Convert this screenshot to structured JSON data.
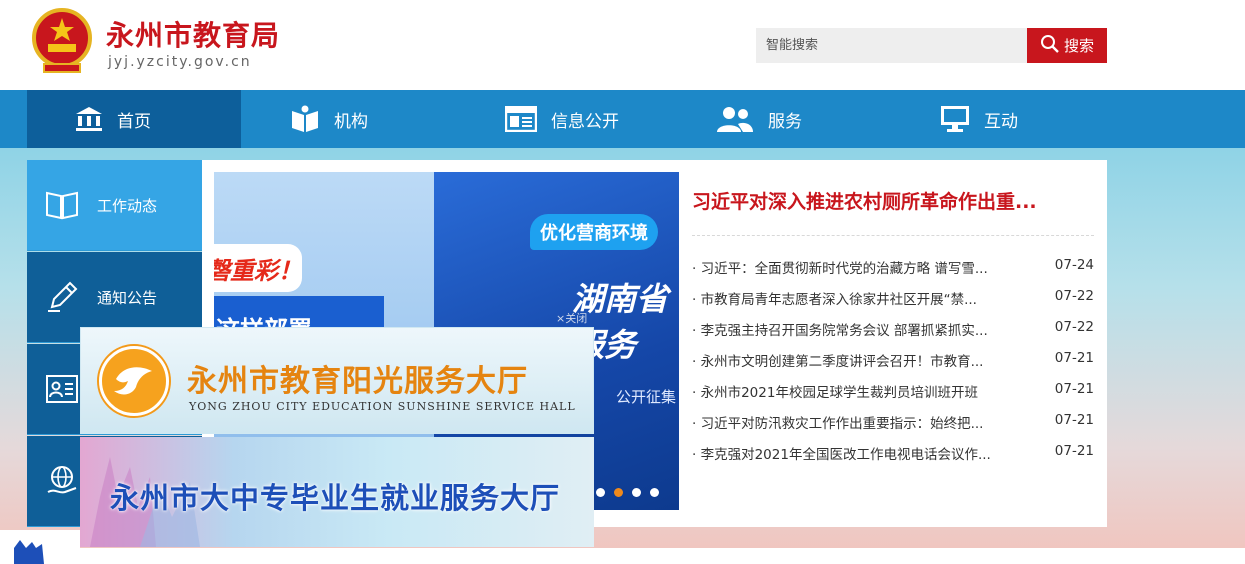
{
  "header": {
    "title": "永州市教育局",
    "domain": "jyj.yzcity.gov.cn",
    "search_placeholder": "智能搜索",
    "search_label": "搜索"
  },
  "nav": [
    {
      "label": "首页",
      "icon": "bank-icon"
    },
    {
      "label": "机构",
      "icon": "book-user-icon"
    },
    {
      "label": "信息公开",
      "icon": "newspaper-icon"
    },
    {
      "label": "服务",
      "icon": "users-icon"
    },
    {
      "label": "互动",
      "icon": "monitor-icon"
    }
  ],
  "sidebar": [
    {
      "label": "工作动态",
      "icon": "open-book-icon"
    },
    {
      "label": "通知公告",
      "icon": "pen-icon"
    },
    {
      "label": "",
      "icon": "id-card-icon"
    },
    {
      "label": "",
      "icon": "globe-hand-icon"
    }
  ],
  "slider": {
    "left_badge": "磬重彩！",
    "left_text": "这样部署",
    "tag": "优化营商环境",
    "big_line1": "湖南省",
    "big_line2": "服务",
    "sub": "公开征集",
    "dots": 5,
    "active_dot": 1
  },
  "news": {
    "headline": "习近平对深入推进农村厕所革命作出重...",
    "items": [
      {
        "title": "· 习近平：全面贯彻新时代党的治藏方略 谱写雪...",
        "date": "07-24"
      },
      {
        "title": "· 市教育局青年志愿者深入徐家井社区开展“禁...",
        "date": "07-22"
      },
      {
        "title": "· 李克强主持召开国务院常务会议 部署抓紧抓实...",
        "date": "07-22"
      },
      {
        "title": "· 永州市文明创建第二季度讲评会召开！市教育...",
        "date": "07-21"
      },
      {
        "title": "· 永州市2021年校园足球学生裁判员培训班开班",
        "date": "07-21"
      },
      {
        "title": "· 习近平对防汛救灾工作作出重要指示：始终把...",
        "date": "07-21"
      },
      {
        "title": "· 李克强对2021年全国医改工作电视电话会议作...",
        "date": "07-21"
      }
    ]
  },
  "floats": {
    "close_label": "×关闭",
    "sunshine_title": "永州市教育阳光服务大厅",
    "sunshine_en": "YONG ZHOU CITY EDUCATION SUNSHINE SERVICE HALL",
    "employment_title": "永州市大中专毕业生就业服务大厅"
  },
  "colors": {
    "brand_red": "#c8161d",
    "nav_blue": "#1d88c8",
    "nav_active": "#0d5f9b",
    "orange": "#e58410"
  }
}
